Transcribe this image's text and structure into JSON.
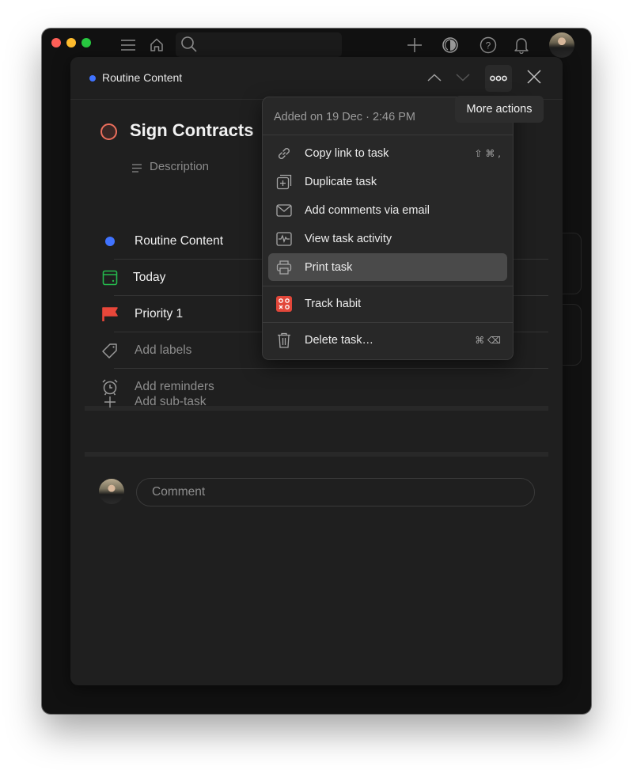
{
  "app": {
    "toolbar": {
      "icons": [
        "menu-icon",
        "home-icon",
        "search-icon",
        "plus-icon",
        "productivity-icon",
        "help-icon",
        "bell-icon"
      ],
      "search_placeholder": ""
    }
  },
  "task": {
    "project": "Routine Content",
    "project_color": "#4073ff",
    "title": "Sign Contracts",
    "description_placeholder": "Description",
    "priority_color": "#eb6e5c",
    "attributes": [
      {
        "icon": "project-dot-icon",
        "label": "Routine Content",
        "muted": false
      },
      {
        "icon": "calendar-icon",
        "label": "Today",
        "muted": false
      },
      {
        "icon": "flag-icon",
        "label": "Priority 1",
        "muted": false
      },
      {
        "icon": "tag-icon",
        "label": "Add labels",
        "muted": true
      },
      {
        "icon": "alarm-icon",
        "label": "Add reminders",
        "muted": true
      }
    ],
    "add_subtask": "Add sub-task",
    "comment_placeholder": "Comment"
  },
  "menu": {
    "meta": "Added on 19 Dec · 2:46 PM",
    "items": [
      {
        "icon": "link-icon",
        "label": "Copy link to task",
        "shortcut": "⇧ ⌘ ,"
      },
      {
        "icon": "duplicate-icon",
        "label": "Duplicate task",
        "shortcut": ""
      },
      {
        "icon": "mail-icon",
        "label": "Add comments via email",
        "shortcut": ""
      },
      {
        "icon": "activity-icon",
        "label": "View task activity",
        "shortcut": ""
      },
      {
        "icon": "print-icon",
        "label": "Print task",
        "shortcut": ""
      },
      {
        "icon": "habit-icon",
        "label": "Track habit",
        "shortcut": ""
      },
      {
        "icon": "trash-icon",
        "label": "Delete task…",
        "shortcut": "⌘ ⌫"
      }
    ],
    "highlighted": "Print task"
  },
  "tooltip": "More actions"
}
